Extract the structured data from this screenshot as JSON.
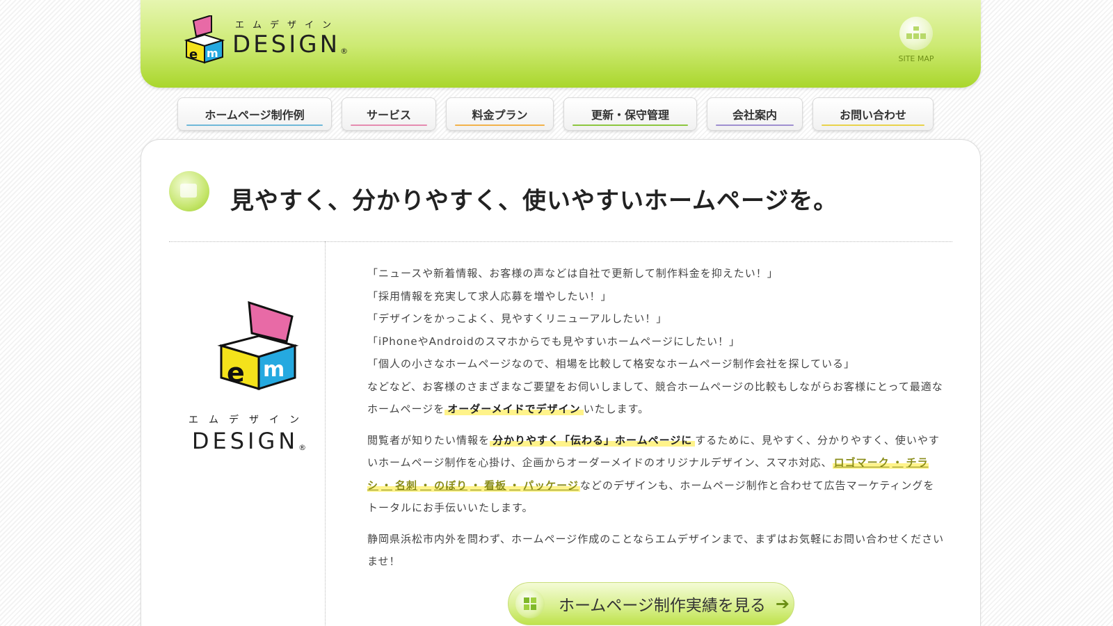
{
  "header": {
    "logo_kana": "エムデザイン",
    "logo_word": "DESIGN",
    "logo_mark": "®",
    "sitemap_label": "SITE MAP"
  },
  "nav": {
    "items": [
      {
        "label": "ホームページ制作例",
        "color": "#6fb8d8"
      },
      {
        "label": "サービス",
        "color": "#e58bb0"
      },
      {
        "label": "料金プラン",
        "color": "#f2b24a"
      },
      {
        "label": "更新・保守管理",
        "color": "#8dc63f"
      },
      {
        "label": "会社案内",
        "color": "#9f8fd0"
      },
      {
        "label": "お問い合わせ",
        "color": "#e8d24a"
      }
    ]
  },
  "main": {
    "hero_title": "見やすく、分かりやすく、使いやすいホームページを。",
    "side_kana": "エムデザイン",
    "side_word": "DESIGN",
    "side_mark": "®",
    "quotes": [
      "「ニュースや新着情報、お客様の声などは自社で更新して制作料金を抑えたい！」",
      "「採用情報を充実して求人応募を増やしたい！」",
      "「デザインをかっこよく、見やすくリニューアルしたい！」",
      "「iPhoneやAndroidのスマホからでも見やすいホームページにしたい！」",
      "「個人の小さなホームページなので、相場を比較して格安なホームページ制作会社を探している」"
    ],
    "para1_prefix": "などなど、お客様のさまざまなご要望をお伺いしまして、競合ホームページの比較もしながらお客様にとって最適なホームページを",
    "para1_highlight": "オーダーメイドでデザイン",
    "para1_suffix": "いたします。",
    "para2_prefix": "閲覧者が知りたい情報を",
    "para2_highlight": "分かりやすく「伝わる」ホームページに",
    "para2_middle": "するために、見やすく、分かりやすく、使いやすいホームページ制作を心掛け、企画からオーダーメイドのオリジナルデザイン、スマホ対応、",
    "para2_links": [
      "ロゴマーク",
      "チラシ",
      "名刺",
      "のぼり",
      "看板",
      "パッケージ"
    ],
    "para2_link_sep": "・",
    "para2_suffix": "などのデザインも、ホームページ制作と合わせて広告マーケティングをトータルにお手伝いいたします。",
    "para3": "静岡県浜松市内外を問わず、ホームページ作成のことならエムデザインまで、まずはお気軽にお問い合わせくださいませ！",
    "cta_label": "ホームページ制作実績を見る",
    "cta_arrow": "➔"
  },
  "colors": {
    "brand_green": "#a9d62c",
    "highlight_yellow": "#fff38a"
  }
}
